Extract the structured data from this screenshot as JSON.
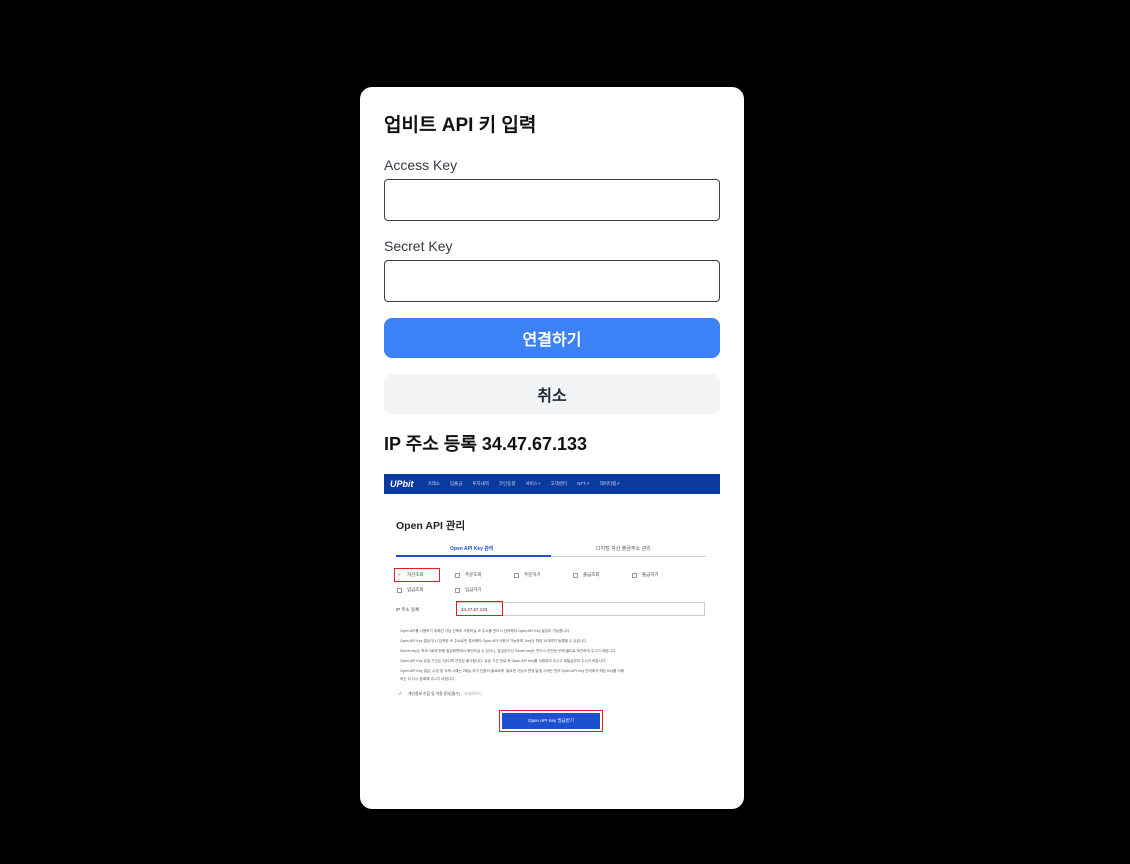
{
  "modal": {
    "title": "업비트 API 키 입력",
    "access_key_label": "Access Key",
    "access_key_value": "",
    "secret_key_label": "Secret Key",
    "secret_key_value": "",
    "connect_label": "연결하기",
    "cancel_label": "취소",
    "ip_title": "IP 주소 등록 34.47.67.133"
  },
  "colors": {
    "primary": "#3b82f6",
    "cancel_bg": "#f3f4f6",
    "overlay": "#000000",
    "upbit_nav": "#0a3a9e",
    "highlight": "#e02020"
  },
  "guide": {
    "logo": "UPbit",
    "nav": [
      "거래소",
      "입출금",
      "투자내역",
      "코인동향",
      "서비스+",
      "고객센터",
      "NFT↗",
      "데이터랩↗"
    ],
    "page_title": "Open API 관리",
    "tab_active": "Open API Key 관리",
    "tab_inactive": "디지털 자산 출금주소 관리",
    "perms": {
      "asset_view": "자산조회",
      "order_view": "주문조회",
      "order": "주문하기",
      "withdraw_view": "출금조회",
      "withdraw": "출금하기",
      "deposit_view": "입금조회",
      "deposit": "입금하기"
    },
    "ip_label": "IP 주소 등록",
    "ip_value": "34.47.67.133",
    "notes": [
      "Open API를 사용하기 위해선 기능 선택과 사용하실 IP 주소를 반드시 입력해야 Open API Key 발급이 가능합니다.",
      "Open API Key 발급 당시 입력한 IP 주소로만 접속해야 Open API 사용이 가능하며, Key당 최대 10개까지 등록할 수 있습니다.",
      "Secret key는 최초 1회에 한해 발급화면에서 확인하실 수 있으니, 발급받으신 Secret key는 반드시 안전한 곳에 별도로 보관하여 주시기 바랍니다.",
      "Open API Key 유효 기간은 1년이며 연장은 불가합니다. 유효 기간 만료 후 Open API Key를 삭제하여 주시고 재발급받아 주시기 바랍니다.",
      "Open API Key 발급, 수정 및 삭제 시에는 2채널 추가 인증이 필요하며, 필요한 기능의 변경 발생 시에는 먼저 Open API Key 관리에서 해당 Key를 삭제",
      "하신 뒤 다시 등록해 주시기 바랍니다."
    ],
    "agree_text": "개인정보 수집 및 이용 동의(필수)",
    "agree_link": "자세히보기",
    "issue_button": "Open API Key 발급받기"
  }
}
